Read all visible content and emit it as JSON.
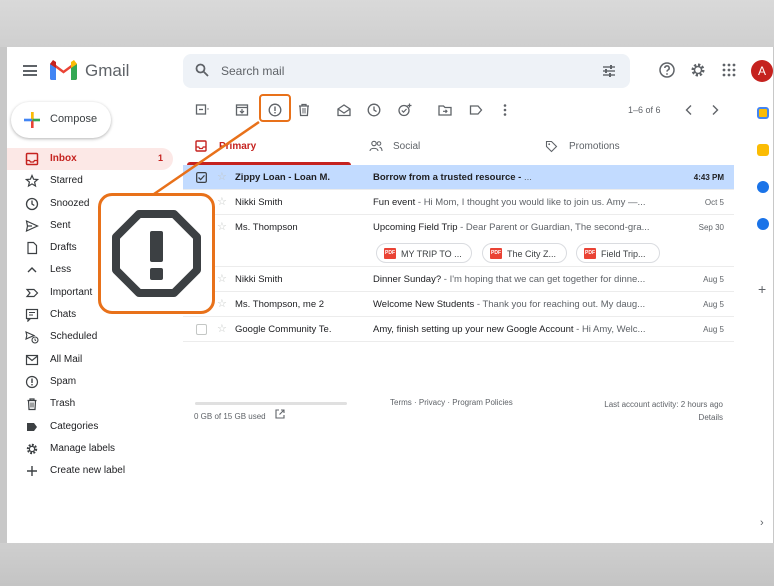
{
  "app": {
    "brand": "Gmail",
    "avatar_initial": "A"
  },
  "search": {
    "placeholder": "Search mail"
  },
  "compose": {
    "label": "Compose"
  },
  "nav": [
    {
      "label": "Inbox",
      "count": "1",
      "icon": "inbox-icon"
    },
    {
      "label": "Starred",
      "icon": "star-icon"
    },
    {
      "label": "Snoozed",
      "icon": "clock-icon"
    },
    {
      "label": "Sent",
      "icon": "send-icon"
    },
    {
      "label": "Drafts",
      "icon": "draft-icon"
    },
    {
      "label": "Less",
      "icon": "chevron-up-icon"
    },
    {
      "label": "Important",
      "icon": "important-icon"
    },
    {
      "label": "Chats",
      "icon": "chat-icon"
    },
    {
      "label": "Scheduled",
      "icon": "scheduled-send-icon"
    },
    {
      "label": "All Mail",
      "icon": "all-mail-icon"
    },
    {
      "label": "Spam",
      "icon": "report-spam-icon"
    },
    {
      "label": "Trash",
      "icon": "trash-icon"
    },
    {
      "label": "Categories",
      "icon": "label-icon"
    },
    {
      "label": "Manage labels",
      "icon": "gear-icon"
    },
    {
      "label": "Create new label",
      "icon": "plus-icon"
    }
  ],
  "toolbar": {
    "pager": "1–6 of 6"
  },
  "tabs": [
    {
      "label": "Primary",
      "icon": "inbox-icon"
    },
    {
      "label": "Social",
      "icon": "people-icon"
    },
    {
      "label": "Promotions",
      "icon": "tag-icon"
    }
  ],
  "emails": [
    {
      "sender": "Zippy Loan - Loan M.",
      "subject": "Borrow from a trusted resource -",
      "snippet": " ...",
      "date": "4:43 PM"
    },
    {
      "sender": "Nikki Smith",
      "subject": "Fun event",
      "snippet": " - Hi Mom, I thought you would like to join us. Amy —...",
      "date": "Oct 5"
    },
    {
      "sender": "Ms. Thompson",
      "subject": "Upcoming Field Trip",
      "snippet": " - Dear Parent or Guardian, The second-gra...",
      "date": "Sep 30",
      "attachments": [
        "MY TRIP TO ...",
        "The City Z...",
        "Field Trip..."
      ]
    },
    {
      "sender": "Nikki Smith",
      "subject": "Dinner Sunday?",
      "snippet": " - I'm hoping that we can get together for dinne...",
      "date": "Aug 5"
    },
    {
      "sender": "Ms. Thompson, me 2",
      "subject": "Welcome New Students",
      "snippet": " - Thank you for reaching out. My daug...",
      "date": "Aug 5"
    },
    {
      "sender": "Google Community Te.",
      "subject": "Amy, finish setting up your new Google Account",
      "snippet": " - Hi Amy, Welc...",
      "date": "Aug 5"
    }
  ],
  "footer": {
    "storage": "0 GB of 15 GB used",
    "links": "Terms · Privacy · Program Policies",
    "activity": "Last account activity: 2 hours ago",
    "details": "Details"
  },
  "colors": {
    "accent": "#e8711a",
    "gmail_red": "#c5221f",
    "selected_row": "#c2dbff"
  }
}
